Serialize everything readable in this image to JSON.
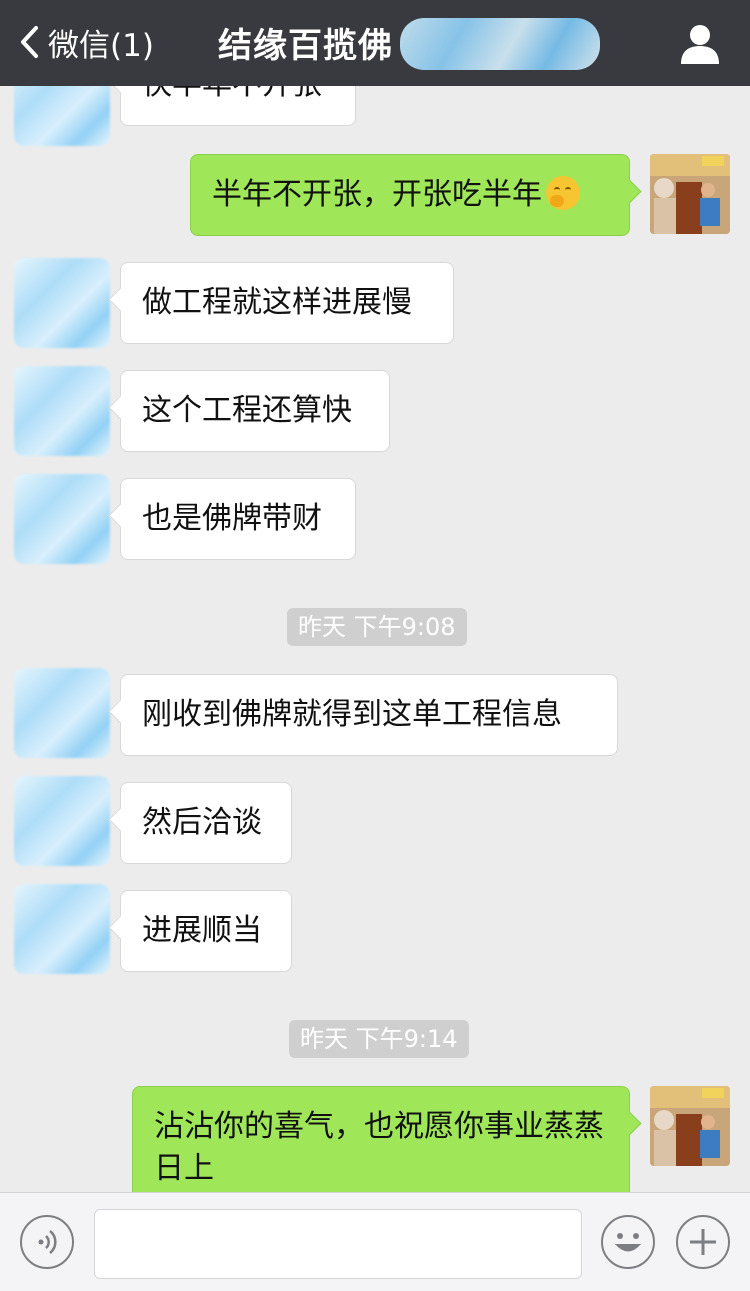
{
  "header": {
    "back_label": "微信(1)",
    "title": "结缘百揽佛"
  },
  "messages": [
    {
      "side": "left",
      "text": "快半年不开张"
    },
    {
      "side": "right",
      "text": "半年不开张，开张吃半年",
      "emoji": "grinning-hand-emoji"
    },
    {
      "side": "left",
      "text": "做工程就这样进展慢"
    },
    {
      "side": "left",
      "text": "这个工程还算快"
    },
    {
      "side": "left",
      "text": "也是佛牌带财"
    },
    {
      "type": "time",
      "text": "昨天 下午9:08"
    },
    {
      "side": "left",
      "text": "刚收到佛牌就得到这单工程信息"
    },
    {
      "side": "left",
      "text": "然后洽谈"
    },
    {
      "side": "left",
      "text": "进展顺当"
    },
    {
      "type": "time",
      "text": "昨天 下午9:14"
    },
    {
      "side": "right",
      "text": "沾沾你的喜气，也祝愿你事业蒸蒸日上"
    }
  ],
  "inputbar": {
    "voice_icon": "voice-icon",
    "emoji_icon": "emoji-icon",
    "plus_icon": "plus-icon",
    "input_value": ""
  },
  "colors": {
    "header_bg": "#393a3f",
    "chat_bg": "#ececec",
    "right_bubble": "#9fe658",
    "left_bubble": "#ffffff",
    "time_pill": "#cfcfcf"
  }
}
